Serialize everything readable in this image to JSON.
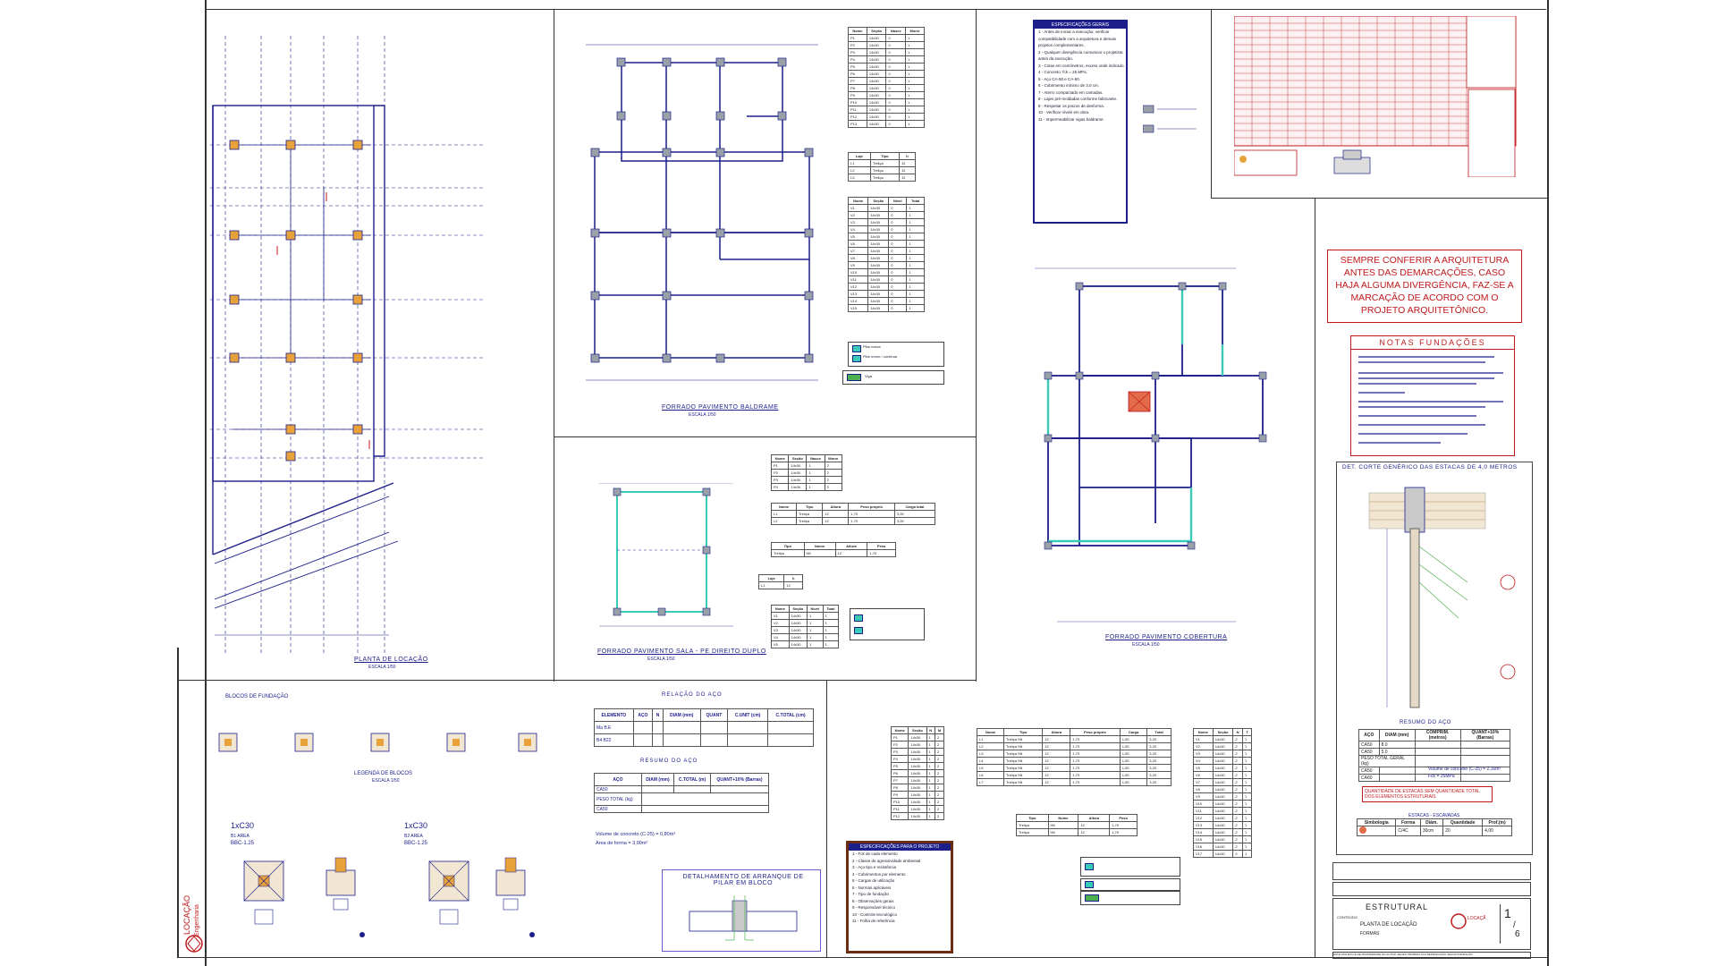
{
  "sheet": {
    "number": "1",
    "total": "6"
  },
  "drawings": {
    "locacao": {
      "title": "PLANTA DE LOCAÇÃO",
      "scale": "ESCALA 1/50"
    },
    "baldrame": {
      "title": "FORRADO PAVIMENTO BALDRAME",
      "scale": "ESCALA 1/50"
    },
    "sala": {
      "title": "FORRADO PAVIMENTO SALA - PE DIREITO DUPLO",
      "scale": "ESCALA 1/50"
    },
    "cobertura": {
      "title": "FORRADO PAVIMENTO COBERTURA",
      "scale": "ESCALA 1/50"
    },
    "blocos": {
      "title": "BLOCOS DE FUNDAÇÃO",
      "legend": "LEGENDA DE BLOCOS",
      "scale": "ESCALA 1/50"
    },
    "estacas": {
      "title": "DET. CORTE GENÉRICO DAS ESTACAS DE 4,0 METROS"
    },
    "detalhe_arranque": {
      "title": "DETALHAMENTO DE ARRANQUE DE PILAR EM BLOCO"
    }
  },
  "blocks": [
    {
      "name": "1xC30",
      "area": "BBC-1.25",
      "label": "B1 AREA"
    },
    {
      "name": "1xC30",
      "area": "BBC-1.25",
      "label": "B2 AREA"
    }
  ],
  "warning": {
    "text": "SEMPRE CONFERIR A ARQUITETURA ANTES DAS DEMARCAÇÕES, CASO HAJA ALGUMA DIVERGÊNCIA, FAZ-SE A MARCAÇÃO DE ACORDO COM O PROJETO ARQUITETÔNICO."
  },
  "notas": {
    "title": "NOTAS FUNDAÇÕES"
  },
  "relacao_aco": {
    "title": "RELAÇÃO DO AÇO",
    "headers": [
      "ELEMENTO",
      "AÇO",
      "N",
      "DIAM (mm)",
      "QUANT",
      "C.UNIT (cm)",
      "C.TOTAL (cm)"
    ],
    "rows": [
      [
        "Ma B.E",
        "",
        "",
        "",
        "",
        "",
        ""
      ],
      [
        "B4 B22",
        "",
        "",
        "",
        "",
        "",
        ""
      ]
    ]
  },
  "resumo_aco": {
    "title": "RESUMO DO AÇO",
    "headers": [
      "AÇO",
      "DIAM (mm)",
      "C.TOTAL (m)",
      "QUANT+10% (Barras)"
    ],
    "rows": [
      [
        "CA50",
        "",
        "",
        ""
      ]
    ],
    "peso_label": "PESO TOTAL (kg)",
    "peso_value": "",
    "volume_text": "Volume de concreto (C-25) = 0,80m³",
    "area_text": "Área de forma = 3,00m²"
  },
  "estaca_resumo": {
    "title": "RESUMO DO AÇO",
    "headers": [
      "AÇO",
      "DIAM (mm)",
      "COMPRIM. (metros)",
      "QUANT+10% (Barras)"
    ],
    "rows": [
      [
        "CA50",
        "8.0",
        "",
        ""
      ],
      [
        "CA50",
        "5.0",
        "",
        ""
      ]
    ],
    "peso_label": "PESO TOTAL GERAL (kg)",
    "peso_rows": [
      [
        "CA50",
        "",
        ""
      ],
      [
        "CA60",
        "",
        ""
      ]
    ],
    "volume_text": "Volume de concreto (C-25) = 2,16m³",
    "fck_text": "Fck = 25MPa",
    "quantity_text": "QUANTIDADE DE ESTACAS SEM QUANTIDADE TOTAL DOS ELEMENTOS ESTRUTURAIS",
    "estacas_label": "ESTACAS - ESCAVADAS",
    "estacas_headers": [
      "Simbologia",
      "Forma",
      "Diâm.",
      "Quantidade",
      "Prof.(m)"
    ],
    "estacas_row": [
      "",
      "C/4C",
      "30cm",
      "20",
      "4,00"
    ]
  },
  "specs": {
    "header": "ESPECIFICAÇÕES GERAIS",
    "lines": [
      "1 - Antes de iniciar a execução, verificar",
      "compatibilidade com a arquitetura e demais",
      "projetos complementares.",
      "2 - Qualquer divergência comunicar o projetista",
      "antes da execução.",
      "3 - Cotas em centímetros, exceto onde indicado.",
      "4 - Concreto: fck = 25 MPa.",
      "5 - Aço CA-50 e CA-60.",
      "6 - Cobrimento mínimo de 3,0 cm.",
      "7 - Aterro compactado em camadas.",
      "8 - Lajes pré-moldadas conforme fabricante.",
      "9 - Respeitar os prazos de desforma.",
      "10 - Verificar níveis em obra.",
      "11 - Impermeabilizar vigas baldrame."
    ]
  },
  "specs2": {
    "header": "ESPECIFICAÇÕES PARA O PROJETO",
    "lines": [
      "1 - Fck de cada elemento",
      "2 - Classe de agressividade ambiental",
      "3 - Aço tipo e resistência",
      "4 - Cobrimentos por elemento",
      "5 - Cargas de utilização",
      "6 - Normas aplicáveis",
      "7 - Tipo de fundação",
      "8 - Observações gerais",
      "9 - Responsável técnico",
      "10 - Controle tecnológico",
      "11 - Folha de referência"
    ]
  },
  "titleblock": {
    "discipline": "ESTRUTURAL",
    "content_label": "CONTEÚDO",
    "content": "PLANTA DE LOCAÇÃO",
    "content2": "FORMAS",
    "company": "LOCAÇÃO Engenharia",
    "footer": "ESTE PROJETO É DE PROPRIEDADE DO AUTOR, SENDO PROIBIDA SUA REPRODUÇÃO SEM AUTORIZAÇÃO"
  },
  "legend_items": [
    {
      "label": "Pilar nasce"
    },
    {
      "label": "Pilar morre / continua"
    },
    {
      "label": "Viga"
    }
  ],
  "colors": {
    "line": "#1c1f8a",
    "red": "#c0191c",
    "pillar": "#e8a23c",
    "cyan": "#3bc9b8",
    "frame": "#6b2e12"
  }
}
